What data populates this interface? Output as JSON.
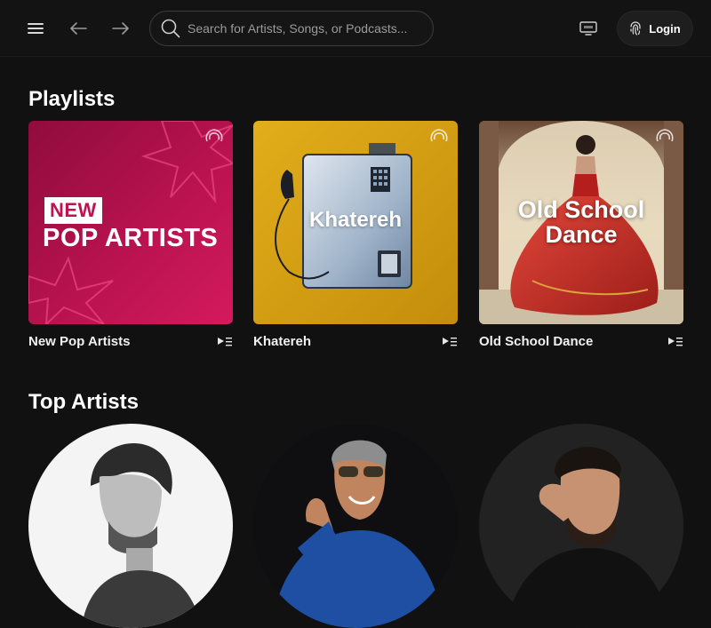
{
  "header": {
    "search_placeholder": "Search for Artists, Songs, or Podcasts...",
    "login_label": "Login"
  },
  "sections": {
    "playlists_title": "Playlists",
    "top_artists_title": "Top Artists"
  },
  "playlists": [
    {
      "name": "New Pop Artists",
      "cover_badge": "NEW",
      "cover_title": "POP ARTISTS"
    },
    {
      "name": "Khatereh",
      "cover_title": "Khatereh"
    },
    {
      "name": "Old School Dance",
      "cover_title_line1": "Old School",
      "cover_title_line2": "Dance"
    }
  ],
  "colors": {
    "background": "#111111",
    "topbar": "#131313",
    "pop_cover": "#c1124f",
    "khatereh_cover": "#d9a514",
    "dance_cover": "#c9332b"
  },
  "icons": {
    "menu": "hamburger-icon",
    "back": "arrow-left-icon",
    "forward": "arrow-right-icon",
    "search": "search-icon",
    "tv": "cast-tv-icon",
    "login": "fingerprint-icon",
    "queue": "play-queue-icon"
  }
}
